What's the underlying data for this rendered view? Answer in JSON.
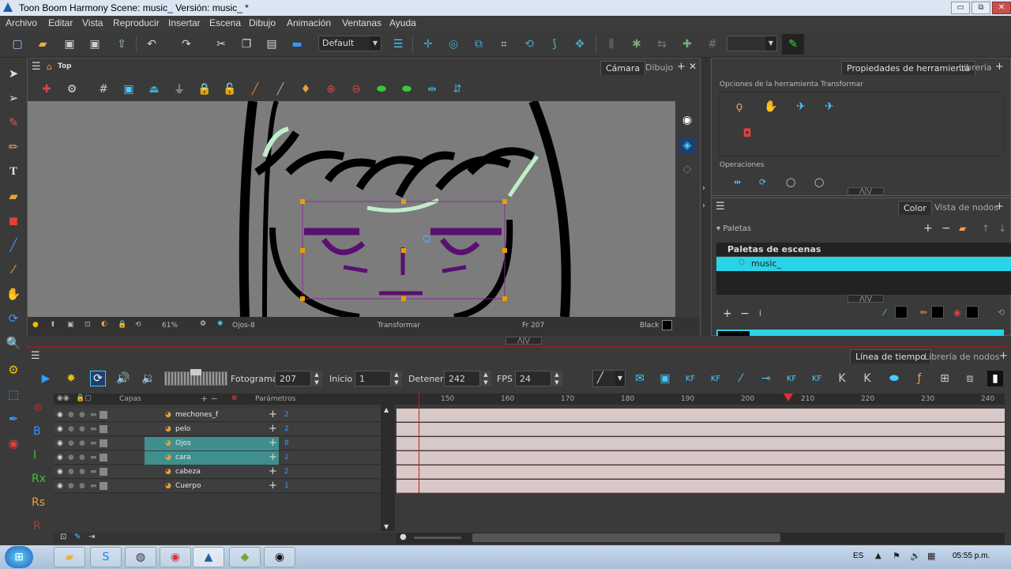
{
  "window": {
    "title": "Toon Boom Harmony Scene: music_ Versión: music_ *",
    "minimize": "▭",
    "restore": "⧉",
    "close": "✕"
  },
  "menu": [
    "Archivo",
    "Editar",
    "Vista",
    "Reproducir",
    "Insertar",
    "Escena",
    "Dibujo",
    "Animación",
    "Ventanas",
    "Ayuda"
  ],
  "toolbar": {
    "preset": "Default"
  },
  "camera_panel": {
    "breadcrumb": "Top",
    "tabs": [
      "Cámara",
      "Dibujo"
    ],
    "status": {
      "zoom": "61%",
      "drawing": "Ojos-8",
      "tool": "Transformar",
      "frame": "Fr 207",
      "color": "Black"
    }
  },
  "tool_props": {
    "tabs": [
      "Propiedades de herramienta",
      "Librería"
    ],
    "section_title": "Opciones de la herramienta Transformar",
    "operations_label": "Operaciones"
  },
  "color_panel": {
    "tabs": [
      "Color",
      "Vista de nodos"
    ],
    "palettes_label": "Paletas",
    "scene_palettes_label": "Paletas de escenas",
    "palette_name": "music_"
  },
  "timeline": {
    "tabs": [
      "Línea de tiempo",
      "Librería de nodos"
    ],
    "frame_label": "Fotograma",
    "frame_value": "207",
    "start_label": "Inicio",
    "start_value": "1",
    "stop_label": "Detener",
    "stop_value": "242",
    "fps_label": "FPS",
    "fps_value": "24",
    "layers_header": "Capas",
    "params_header": "Parámetros",
    "ruler": [
      "150",
      "160",
      "170",
      "180",
      "190",
      "200",
      "210",
      "220",
      "230",
      "240"
    ],
    "layers": [
      {
        "name": "mechones_f",
        "param": "2",
        "selected": false
      },
      {
        "name": "pelo",
        "param": "2",
        "selected": false
      },
      {
        "name": "Ojos",
        "param": "8",
        "selected": true
      },
      {
        "name": "cara",
        "param": "2",
        "selected": true
      },
      {
        "name": "cabeza",
        "param": "2",
        "selected": false
      },
      {
        "name": "Cuerpo",
        "param": "1",
        "selected": false
      }
    ]
  },
  "taskbar": {
    "lang": "ES",
    "clock": "05:55 p.m."
  }
}
